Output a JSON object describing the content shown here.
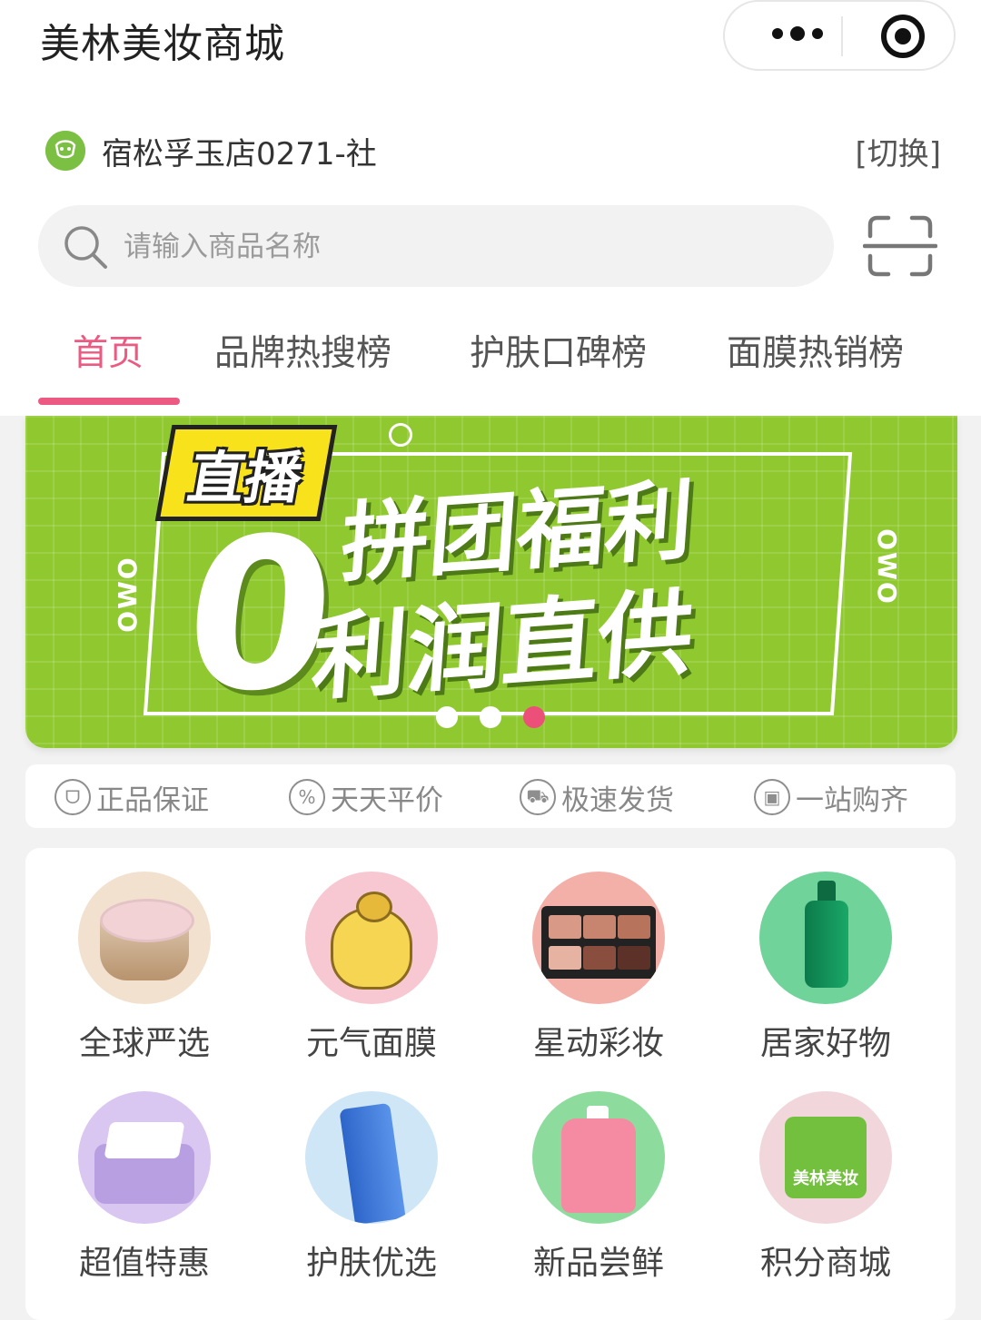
{
  "header": {
    "title": "美林美妆商城"
  },
  "store": {
    "name": "宿松孚玉店0271-社",
    "switch_label": "[切换]"
  },
  "search": {
    "placeholder": "请输入商品名称"
  },
  "tabs": [
    {
      "label": "首页",
      "active": true
    },
    {
      "label": "品牌热搜榜"
    },
    {
      "label": "护肤口碑榜"
    },
    {
      "label": "面膜热销榜"
    }
  ],
  "banner": {
    "tag": "直播",
    "line1": "拼团福利",
    "line2": "利润直供",
    "big_number": "0",
    "deco": "OWO",
    "slide_count": 3,
    "active_slide": 3
  },
  "guarantees": [
    {
      "icon": "cat-icon",
      "label": "正品保证"
    },
    {
      "icon": "percent-icon",
      "label": "天天平价"
    },
    {
      "icon": "truck-icon",
      "label": "极速发货"
    },
    {
      "icon": "bag-icon",
      "label": "一站购齐"
    }
  ],
  "categories": [
    {
      "label": "全球严选",
      "bg": "#f3e1cf"
    },
    {
      "label": "元气面膜",
      "bg": "#f7c8d2"
    },
    {
      "label": "星动彩妆",
      "bg": "#f3b0a9"
    },
    {
      "label": "居家好物",
      "bg": "#6fd39a"
    },
    {
      "label": "超值特惠",
      "bg": "#d9c6f1"
    },
    {
      "label": "护肤优选",
      "bg": "#cfe6f7"
    },
    {
      "label": "新品尝鲜",
      "bg": "#8ddc9e"
    },
    {
      "label": "积分商城",
      "bg": "#f1d7dc"
    }
  ],
  "shop_logo_text": "美林美妆",
  "colors": {
    "accent": "#ec5a82",
    "banner_green": "#8fc92f"
  }
}
